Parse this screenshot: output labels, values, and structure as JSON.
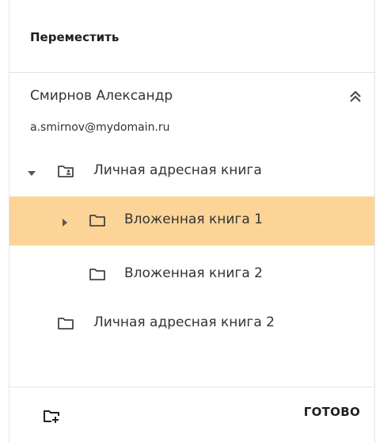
{
  "dialog": {
    "title": "Переместить",
    "done_label": "ГОТОВО"
  },
  "account": {
    "name": "Смирнов Александр",
    "email": "a.smirnov@mydomain.ru"
  },
  "tree": {
    "items": [
      {
        "label": "Личная адресная книга",
        "level": 0,
        "expanded": true,
        "has_children": true,
        "shared": true,
        "selected": false
      },
      {
        "label": "Вложенная книга 1",
        "level": 1,
        "expanded": false,
        "has_children": true,
        "shared": false,
        "selected": true
      },
      {
        "label": "Вложенная книга 2",
        "level": 1,
        "expanded": false,
        "has_children": false,
        "shared": false,
        "selected": false
      },
      {
        "label": "Личная адресная книга 2",
        "level": 0,
        "expanded": false,
        "has_children": false,
        "shared": false,
        "selected": false
      }
    ]
  },
  "colors": {
    "selected_row": "#fdd498",
    "text": "#333333",
    "divider": "#e2e2e2"
  },
  "icons": {
    "collapse": "double-chevron-up-icon",
    "folder": "folder-icon",
    "shared_folder": "folder-shared-icon",
    "new_folder": "folder-plus-icon",
    "expanded_caret": "caret-down-icon",
    "collapsed_caret": "caret-right-icon"
  }
}
